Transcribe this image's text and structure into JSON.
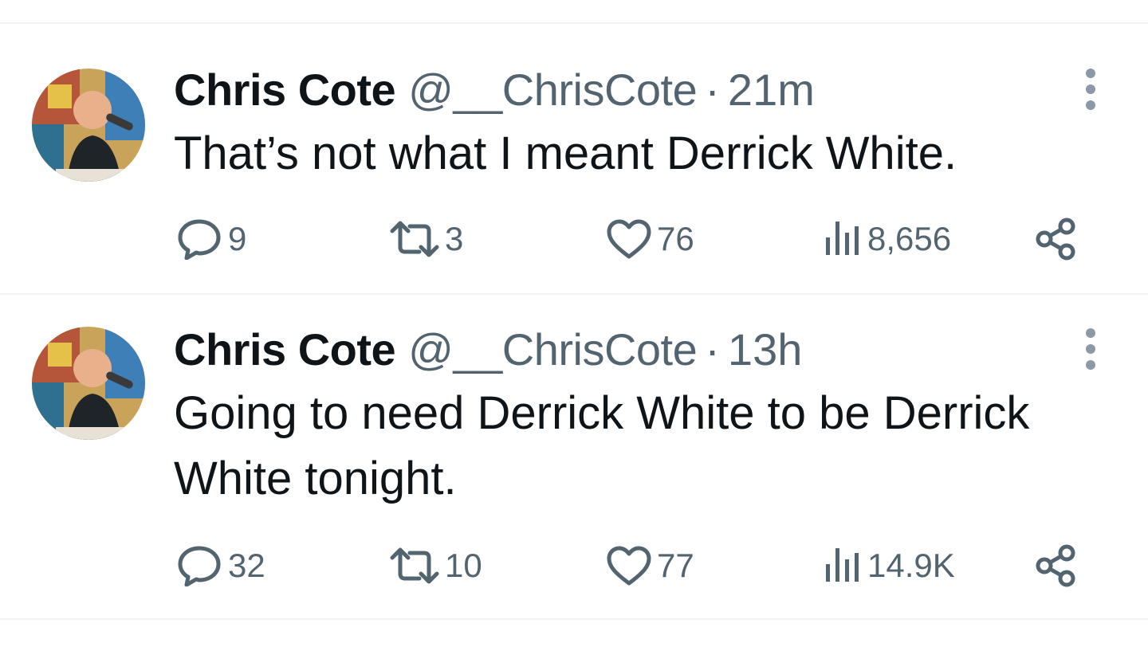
{
  "tweets": [
    {
      "author_name": "Chris Cote",
      "handle": "@__ChrisCote",
      "separator": "·",
      "time": "21m",
      "text": "That’s not what I meant Derrick White.",
      "replies": "9",
      "retweets": "3",
      "likes": "76",
      "views": "8,656"
    },
    {
      "author_name": "Chris Cote",
      "handle": "@__ChrisCote",
      "separator": "·",
      "time": "13h",
      "text": "Going to need Derrick White to be Derrick White tonight.",
      "replies": "32",
      "retweets": "10",
      "likes": "77",
      "views": "14.9K"
    }
  ],
  "icons": {
    "reply": "reply-icon",
    "retweet": "retweet-icon",
    "like": "heart-icon",
    "views": "views-icon",
    "share": "share-icon",
    "more": "more-options-icon"
  },
  "colors": {
    "text_primary": "#0f1419",
    "text_secondary": "#536471",
    "divider": "#eff3f4"
  }
}
